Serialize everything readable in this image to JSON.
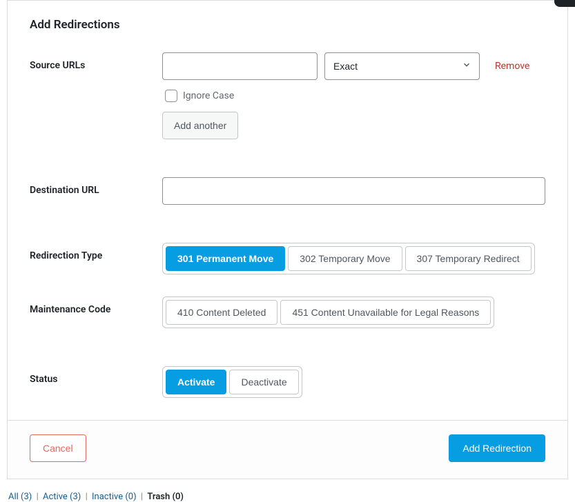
{
  "header": {
    "title": "Add Redirections"
  },
  "form": {
    "source": {
      "label": "Source URLs",
      "value": "",
      "match_type": "Exact",
      "remove_label": "Remove",
      "ignore_case_label": "Ignore Case",
      "add_another_label": "Add another"
    },
    "destination": {
      "label": "Destination URL",
      "value": ""
    },
    "redirection_type": {
      "label": "Redirection Type",
      "options": {
        "r301": "301 Permanent Move",
        "r302": "302 Temporary Move",
        "r307": "307 Temporary Redirect"
      }
    },
    "maintenance_code": {
      "label": "Maintenance Code",
      "options": {
        "r410": "410 Content Deleted",
        "r451": "451 Content Unavailable for Legal Reasons"
      }
    },
    "status": {
      "label": "Status",
      "activate": "Activate",
      "deactivate": "Deactivate"
    }
  },
  "footer": {
    "cancel": "Cancel",
    "submit": "Add Redirection"
  },
  "filters": {
    "all": {
      "label": "All",
      "count": "(3)"
    },
    "active": {
      "label": "Active",
      "count": "(3)"
    },
    "inactive": {
      "label": "Inactive",
      "count": "(0)"
    },
    "trash": {
      "label": "Trash",
      "count": "(0)"
    }
  }
}
